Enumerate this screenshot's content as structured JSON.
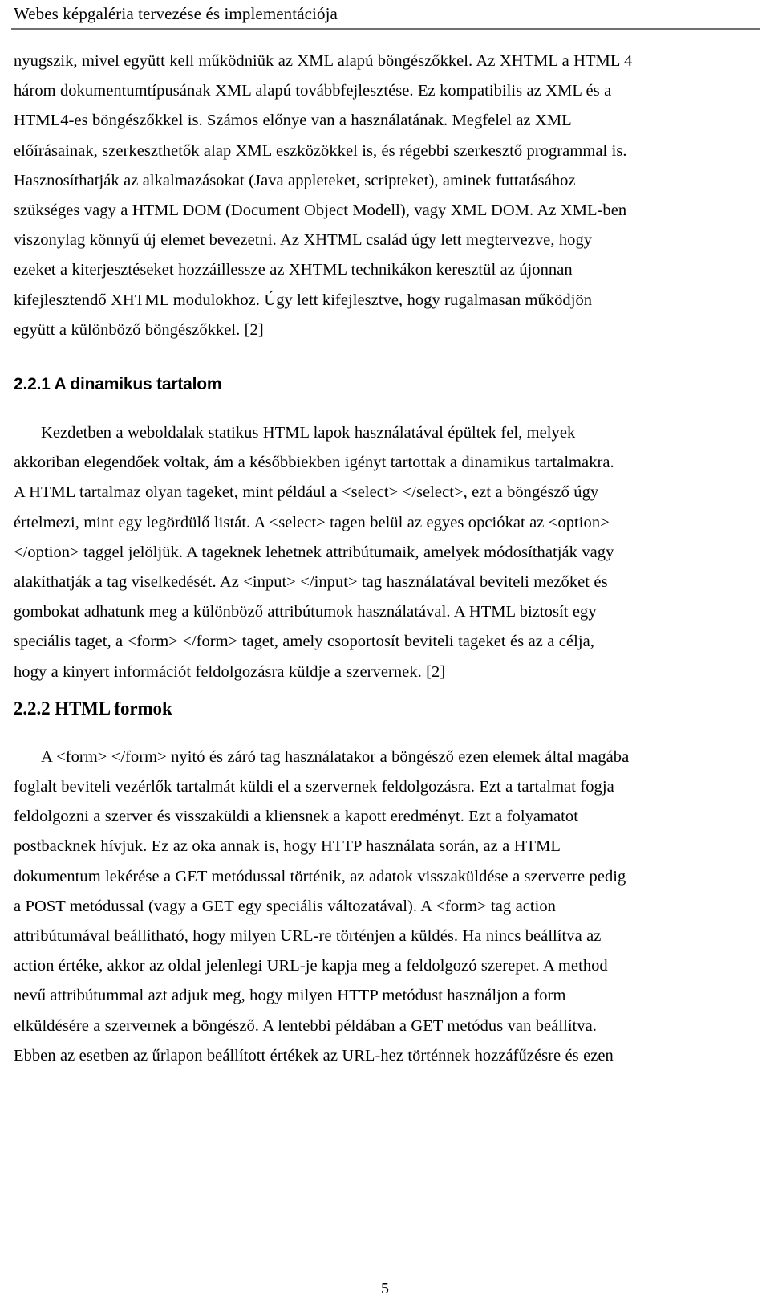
{
  "document": {
    "header_title": "Webes képgaléria tervezése és implementációja",
    "page_number": "5",
    "language": "hu"
  },
  "body": {
    "paragraph_1": {
      "lines": [
        "nyugszik, mivel együtt kell működniük az XML alapú böngészőkkel. Az XHTML a HTML 4",
        "három dokumentumtípusának XML alapú továbbfejlesztése. Ez kompatibilis az XML és a",
        "HTML4-es böngészőkkel is. Számos előnye van a használatának. Megfelel az XML",
        "előírásainak, szerkeszthetők alap XML eszközökkel is, és régebbi szerkesztő programmal is.",
        "Hasznosíthatják az alkalmazásokat (Java appleteket, scripteket), aminek futtatásához",
        "szükséges vagy a HTML DOM (Document Object Modell), vagy XML DOM. Az XML-ben",
        "viszonylag könnyű új elemet bevezetni. Az XHTML család úgy lett megtervezve, hogy",
        "ezeket a kiterjesztéseket hozzáillessze az XHTML technikákon keresztül az újonnan",
        "kifejlesztendő XHTML modulokhoz. Úgy lett kifejlesztve, hogy rugalmasan működjön",
        "együtt a különböző böngészőkkel. [2]"
      ]
    },
    "heading_221": "2.2.1 A dinamikus tartalom",
    "paragraph_2": {
      "lines": [
        "Kezdetben a weboldalak statikus HTML lapok használatával épültek fel, melyek",
        "akkoriban elegendőek voltak, ám a későbbiekben igényt tartottak a dinamikus tartalmakra.",
        "A HTML tartalmaz olyan tageket, mint például a <select> </select>, ezt a böngésző úgy",
        "értelmezi, mint egy legördülő listát. A <select> tagen belül az egyes opciókat az <option>",
        "</option> taggel jelöljük. A tageknek lehetnek attribútumaik, amelyek módosíthatják vagy",
        "alakíthatják a tag viselkedését. Az <input> </input> tag használatával beviteli mezőket és",
        "gombokat adhatunk meg a különböző attribútumok használatával. A HTML biztosít egy",
        "speciális taget, a <form> </form> taget, amely csoportosít beviteli tageket és az a célja,",
        "hogy a kinyert információt feldolgozásra küldje a szervernek. [2]"
      ]
    },
    "heading_222": "2.2.2 HTML formok",
    "paragraph_3": {
      "lines": [
        "A <form> </form> nyitó és záró tag használatakor a böngésző ezen elemek által magába",
        "foglalt beviteli vezérlők tartalmát küldi el a szervernek feldolgozásra. Ezt a tartalmat fogja",
        "feldolgozni a szerver és visszaküldi a kliensnek a kapott eredményt. Ezt a folyamatot",
        "postbacknek hívjuk. Ez az oka annak is, hogy HTTP használata során, az a HTML",
        "dokumentum lekérése a GET metódussal történik, az adatok visszaküldése a szerverre pedig",
        "a POST metódussal (vagy a GET egy speciális változatával). A <form> tag action",
        "attribútumával beállítható, hogy milyen URL-re történjen a küldés. Ha nincs beállítva az",
        "action értéke, akkor az oldal jelenlegi URL-je kapja meg a feldolgozó szerepet. A method",
        "nevű attribútummal azt adjuk meg, hogy milyen HTTP metódust használjon a form",
        "elküldésére a szervernek a böngésző. A lentebbi példában a GET metódus van beállítva.",
        "Ebben az esetben az űrlapon beállított értékek az URL-hez történnek hozzáfűzésre és ezen"
      ]
    }
  }
}
